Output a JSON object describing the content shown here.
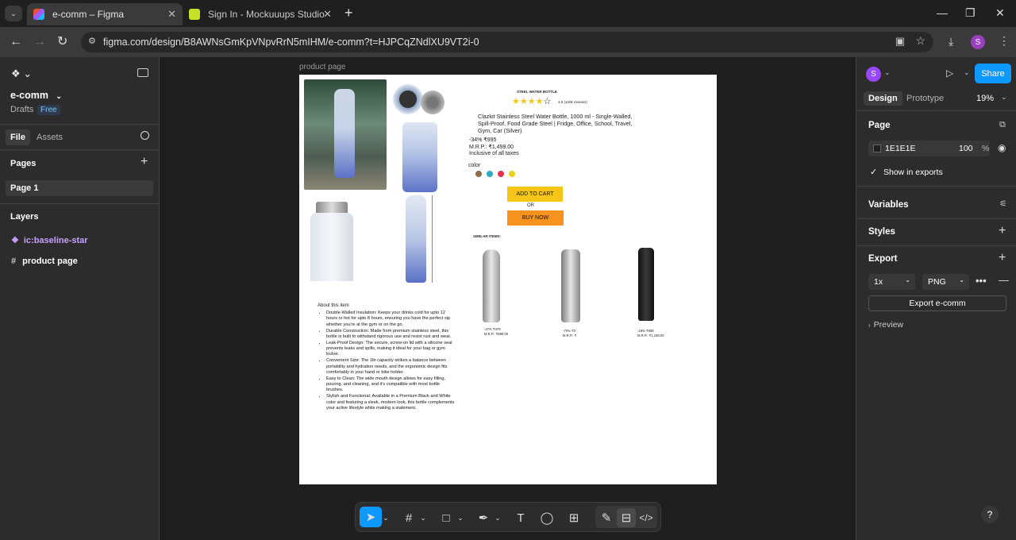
{
  "browser": {
    "tabs": [
      {
        "label": "e-comm – Figma",
        "active": true
      },
      {
        "label": "Sign In - Mockuuups Studio",
        "active": false
      }
    ],
    "url": "figma.com/design/B8AWNsGmKpVNpvRrN5mIHM/e-comm?t=HJPCqZNdlXU9VT2i-0",
    "profile_initial": "S"
  },
  "left_panel": {
    "file_name": "e-comm",
    "drafts_label": "Drafts",
    "plan_badge": "Free",
    "tabs": [
      "File",
      "Assets"
    ],
    "pages_heading": "Pages",
    "pages": [
      "Page 1"
    ],
    "layers_heading": "Layers",
    "layers": [
      {
        "name": "ic:baseline-star",
        "type": "component"
      },
      {
        "name": "product page",
        "type": "frame"
      }
    ]
  },
  "canvas": {
    "frame_label": "product page"
  },
  "product_page": {
    "heading": "STEEL WATER BOTTLE",
    "rating": "4.5 (120k reviews)",
    "stars_filled": 4,
    "stars_total": 5,
    "title": "Clazkit Stainless Steel Water Bottle, 1000 ml - Single-Walled, Spill-Proof, Food Grade Steel | Fridge, Office, School, Travel, Gym, Car (Silver)",
    "discount_price": "-34% ₹995",
    "mrp": "M.R.P.: ₹1,499.00",
    "tax_note": "Inclusive of all taxes",
    "color_label": "color",
    "colors": [
      "#8B6B4A",
      "#2FA8C9",
      "#E8334A",
      "#E8D21A"
    ],
    "add_to_cart": "ADD TO CART",
    "or_label": "OR",
    "buy_now": "BUY NOW",
    "similar_heading": "SIMILAR ITEMS:",
    "similar": [
      {
        "price": "-47% ₹479",
        "mrp": "M.R.P.: ₹899.00"
      },
      {
        "price": "-70% ₹3",
        "mrp": "M.R.P.: ₹"
      },
      {
        "price": "-18% ₹658",
        "mrp": "M.R.P.: ₹1,169.00"
      }
    ],
    "about_heading": "About this item",
    "about_items": [
      "Double-Walled Insulation: Keeps your drinks cold for upto 12 hours or hot for upto 8 hours, ensuring you have the perfect sip whether you're at the gym or on the go.",
      "Durable Construction: Made from premium stainless steel, this bottle is built to withstand rigorous use and resist rust and wear.",
      "Leak-Proof Design: The secure, screw-on lid with a silicone seal prevents leaks and spills, making it ideal for your bag or gym locker.",
      "Convenient Size: The 1ltr capacity strikes a balance between portability and hydration needs, and the ergonomic design fits comfortably in your hand or bike holder.",
      "Easy to Clean: The wide mouth design allows for easy filling, pouring, and cleaning, and it's compatible with most bottle brushes.",
      "Stylish and Functional: Available in a Premium Black and White color and featuring a sleek, modern look, this bottle complements your active lifestyle while making a statement."
    ]
  },
  "right_panel": {
    "avatar_initial": "S",
    "share_label": "Share",
    "tabs": [
      "Design",
      "Prototype"
    ],
    "zoom": "19%",
    "page_heading": "Page",
    "page_color_hex": "1E1E1E",
    "page_opacity": "100",
    "percent_sign": "%",
    "show_in_exports": "Show in exports",
    "show_in_exports_checked": true,
    "variables_heading": "Variables",
    "styles_heading": "Styles",
    "export_heading": "Export",
    "export_scale": "1x",
    "export_format": "PNG",
    "export_button": "Export e-comm",
    "preview_label": "Preview"
  },
  "toolbar": {
    "tools": [
      "move-tool",
      "frame-tool",
      "shape-tool",
      "pen-tool",
      "text-tool",
      "comment-tool",
      "actions-tool",
      "draw-mode",
      "design-mode",
      "dev-mode"
    ]
  },
  "help_label": "?",
  "colors": {
    "accent": "#0D99FF",
    "avatar": "#9747FF",
    "component": "#C7A0FF"
  }
}
